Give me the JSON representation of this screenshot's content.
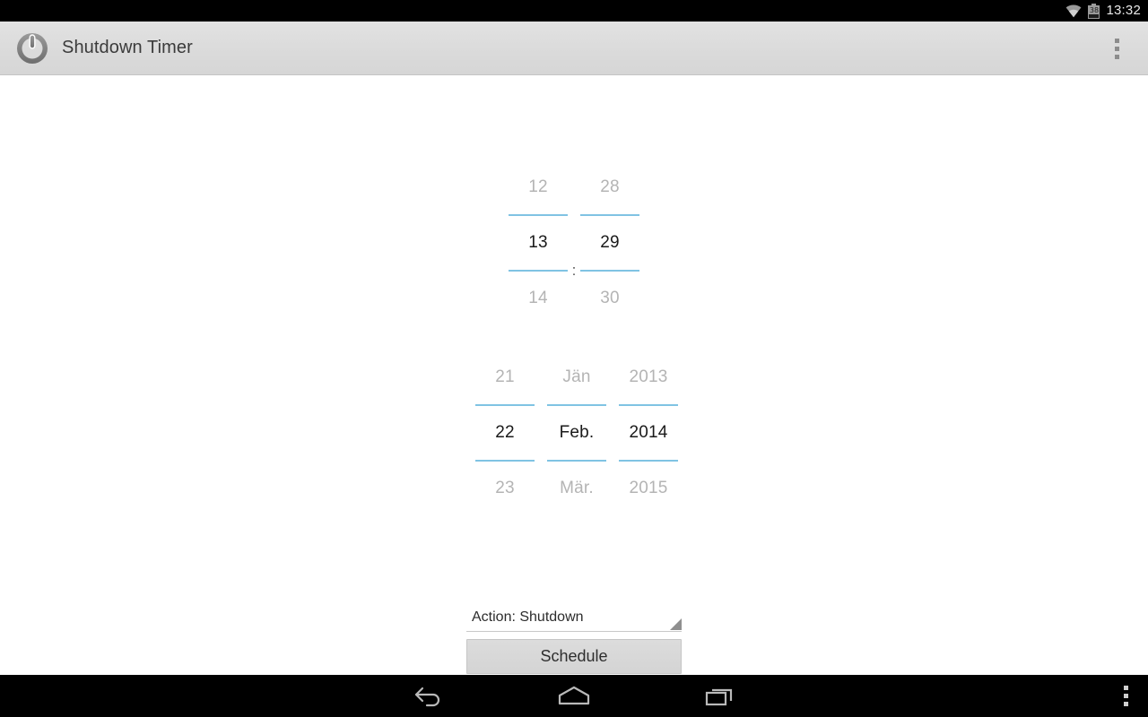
{
  "status_bar": {
    "wifi_icon": "wifi-icon",
    "battery_icon": "battery-icon",
    "battery_level": "38",
    "clock": "13:32"
  },
  "action_bar": {
    "app_icon": "power-icon",
    "title": "Shutdown Timer",
    "overflow_icon": "overflow-menu-icon"
  },
  "time_picker": {
    "hour": {
      "previous": "12",
      "selected": "13",
      "next": "14"
    },
    "separator": ":",
    "minute": {
      "previous": "28",
      "selected": "29",
      "next": "30"
    }
  },
  "date_picker": {
    "day": {
      "previous": "21",
      "selected": "22",
      "next": "23"
    },
    "month": {
      "previous": "Jän",
      "selected": "Feb.",
      "next": "Mär."
    },
    "year": {
      "previous": "2013",
      "selected": "2014",
      "next": "2015"
    }
  },
  "action_spinner": {
    "value": "Action: Shutdown",
    "arrow_icon": "dropdown-triangle-icon"
  },
  "schedule_button": {
    "label": "Schedule"
  },
  "nav_bar": {
    "back_icon": "back-arrow-icon",
    "home_icon": "home-icon",
    "recents_icon": "recent-apps-icon",
    "overflow_icon": "overflow-menu-icon"
  },
  "colors": {
    "accent_underline": "#80c3e3",
    "action_bar_bg": "#dadada",
    "selected_text": "#1a1a1a",
    "unselected_text": "#b4b4b4",
    "button_bg": "#d4d4d4",
    "system_bar_bg": "#000000"
  }
}
